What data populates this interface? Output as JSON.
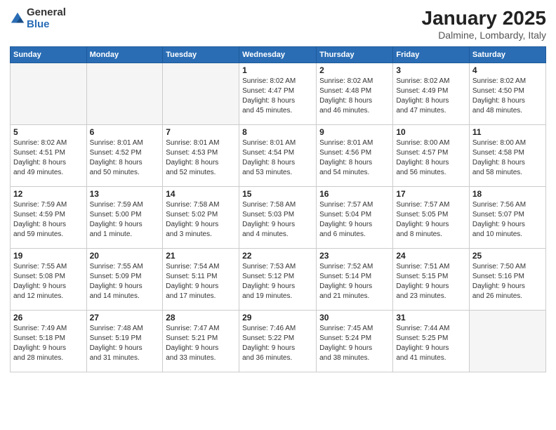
{
  "logo": {
    "general": "General",
    "blue": "Blue"
  },
  "header": {
    "month": "January 2025",
    "location": "Dalmine, Lombardy, Italy"
  },
  "weekdays": [
    "Sunday",
    "Monday",
    "Tuesday",
    "Wednesday",
    "Thursday",
    "Friday",
    "Saturday"
  ],
  "weeks": [
    [
      {
        "day": "",
        "info": ""
      },
      {
        "day": "",
        "info": ""
      },
      {
        "day": "",
        "info": ""
      },
      {
        "day": "1",
        "info": "Sunrise: 8:02 AM\nSunset: 4:47 PM\nDaylight: 8 hours\nand 45 minutes."
      },
      {
        "day": "2",
        "info": "Sunrise: 8:02 AM\nSunset: 4:48 PM\nDaylight: 8 hours\nand 46 minutes."
      },
      {
        "day": "3",
        "info": "Sunrise: 8:02 AM\nSunset: 4:49 PM\nDaylight: 8 hours\nand 47 minutes."
      },
      {
        "day": "4",
        "info": "Sunrise: 8:02 AM\nSunset: 4:50 PM\nDaylight: 8 hours\nand 48 minutes."
      }
    ],
    [
      {
        "day": "5",
        "info": "Sunrise: 8:02 AM\nSunset: 4:51 PM\nDaylight: 8 hours\nand 49 minutes."
      },
      {
        "day": "6",
        "info": "Sunrise: 8:01 AM\nSunset: 4:52 PM\nDaylight: 8 hours\nand 50 minutes."
      },
      {
        "day": "7",
        "info": "Sunrise: 8:01 AM\nSunset: 4:53 PM\nDaylight: 8 hours\nand 52 minutes."
      },
      {
        "day": "8",
        "info": "Sunrise: 8:01 AM\nSunset: 4:54 PM\nDaylight: 8 hours\nand 53 minutes."
      },
      {
        "day": "9",
        "info": "Sunrise: 8:01 AM\nSunset: 4:56 PM\nDaylight: 8 hours\nand 54 minutes."
      },
      {
        "day": "10",
        "info": "Sunrise: 8:00 AM\nSunset: 4:57 PM\nDaylight: 8 hours\nand 56 minutes."
      },
      {
        "day": "11",
        "info": "Sunrise: 8:00 AM\nSunset: 4:58 PM\nDaylight: 8 hours\nand 58 minutes."
      }
    ],
    [
      {
        "day": "12",
        "info": "Sunrise: 7:59 AM\nSunset: 4:59 PM\nDaylight: 8 hours\nand 59 minutes."
      },
      {
        "day": "13",
        "info": "Sunrise: 7:59 AM\nSunset: 5:00 PM\nDaylight: 9 hours\nand 1 minute."
      },
      {
        "day": "14",
        "info": "Sunrise: 7:58 AM\nSunset: 5:02 PM\nDaylight: 9 hours\nand 3 minutes."
      },
      {
        "day": "15",
        "info": "Sunrise: 7:58 AM\nSunset: 5:03 PM\nDaylight: 9 hours\nand 4 minutes."
      },
      {
        "day": "16",
        "info": "Sunrise: 7:57 AM\nSunset: 5:04 PM\nDaylight: 9 hours\nand 6 minutes."
      },
      {
        "day": "17",
        "info": "Sunrise: 7:57 AM\nSunset: 5:05 PM\nDaylight: 9 hours\nand 8 minutes."
      },
      {
        "day": "18",
        "info": "Sunrise: 7:56 AM\nSunset: 5:07 PM\nDaylight: 9 hours\nand 10 minutes."
      }
    ],
    [
      {
        "day": "19",
        "info": "Sunrise: 7:55 AM\nSunset: 5:08 PM\nDaylight: 9 hours\nand 12 minutes."
      },
      {
        "day": "20",
        "info": "Sunrise: 7:55 AM\nSunset: 5:09 PM\nDaylight: 9 hours\nand 14 minutes."
      },
      {
        "day": "21",
        "info": "Sunrise: 7:54 AM\nSunset: 5:11 PM\nDaylight: 9 hours\nand 17 minutes."
      },
      {
        "day": "22",
        "info": "Sunrise: 7:53 AM\nSunset: 5:12 PM\nDaylight: 9 hours\nand 19 minutes."
      },
      {
        "day": "23",
        "info": "Sunrise: 7:52 AM\nSunset: 5:14 PM\nDaylight: 9 hours\nand 21 minutes."
      },
      {
        "day": "24",
        "info": "Sunrise: 7:51 AM\nSunset: 5:15 PM\nDaylight: 9 hours\nand 23 minutes."
      },
      {
        "day": "25",
        "info": "Sunrise: 7:50 AM\nSunset: 5:16 PM\nDaylight: 9 hours\nand 26 minutes."
      }
    ],
    [
      {
        "day": "26",
        "info": "Sunrise: 7:49 AM\nSunset: 5:18 PM\nDaylight: 9 hours\nand 28 minutes."
      },
      {
        "day": "27",
        "info": "Sunrise: 7:48 AM\nSunset: 5:19 PM\nDaylight: 9 hours\nand 31 minutes."
      },
      {
        "day": "28",
        "info": "Sunrise: 7:47 AM\nSunset: 5:21 PM\nDaylight: 9 hours\nand 33 minutes."
      },
      {
        "day": "29",
        "info": "Sunrise: 7:46 AM\nSunset: 5:22 PM\nDaylight: 9 hours\nand 36 minutes."
      },
      {
        "day": "30",
        "info": "Sunrise: 7:45 AM\nSunset: 5:24 PM\nDaylight: 9 hours\nand 38 minutes."
      },
      {
        "day": "31",
        "info": "Sunrise: 7:44 AM\nSunset: 5:25 PM\nDaylight: 9 hours\nand 41 minutes."
      },
      {
        "day": "",
        "info": ""
      }
    ]
  ]
}
